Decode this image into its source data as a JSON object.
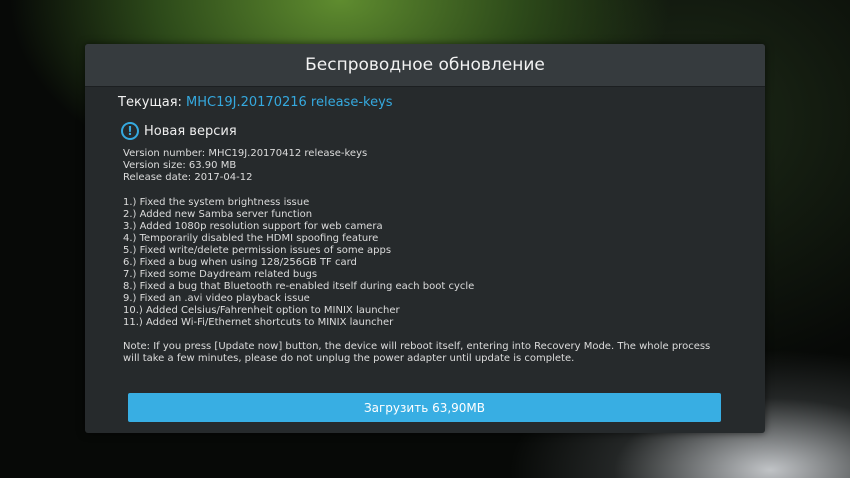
{
  "dialog": {
    "title": "Беспроводное обновление",
    "current_label": "Текущая:",
    "current_value": "MHC19J.20170216 release-keys",
    "new_version_label": "Новая версия",
    "details": [
      "Version number:  MHC19J.20170412 release-keys",
      "Version size:  63.90 MB",
      "Release date:  2017-04-12"
    ],
    "changelog": [
      "1.) Fixed the system brightness issue",
      "2.) Added new Samba server function",
      "3.) Added 1080p resolution support for web camera",
      "4.) Temporarily disabled the HDMI spoofing feature",
      "5.) Fixed write/delete permission issues of some apps",
      "6.) Fixed a bug when using 128/256GB TF card",
      "7.) Fixed some Daydream related bugs",
      "8.) Fixed a bug that Bluetooth re-enabled itself during each boot cycle",
      "9.) Fixed an .avi video playback issue",
      "10.) Added Celsius/Fahrenheit option to MINIX launcher",
      "11.) Added Wi-Fi/Ethernet shortcuts to MINIX launcher"
    ],
    "note": "Note: If you press [Update now] button, the device will reboot itself, entering into Recovery Mode. The whole process will take a few minutes, please do not unplug the power adapter until update is complete.",
    "button_label": "Загрузить  63,90MB"
  },
  "icons": {
    "info": "info-icon"
  },
  "colors": {
    "accent": "#35a9df",
    "button": "#38aee3",
    "panel": "#262a2c",
    "header": "#363b3e"
  }
}
